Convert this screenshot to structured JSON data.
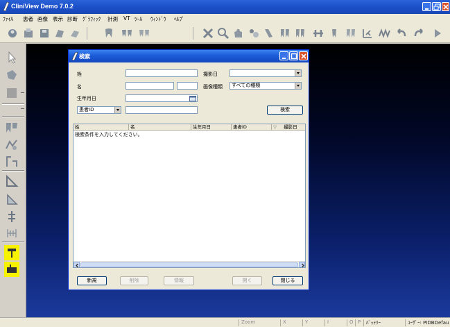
{
  "app": {
    "title": "CliniView Demo 7.0.2",
    "menu": [
      "ﾌｧｲﾙ",
      "患者",
      "画像",
      "表示",
      "診断",
      "ｸﾞﾗﾌｨｯｸ",
      "計測",
      "VT",
      "ﾂｰﾙ",
      "ｳｨﾝﾄﾞｳ",
      "ﾍﾙﾌﾟ"
    ]
  },
  "colors": {
    "titlebar": "#1b50c9",
    "workspace_top": "#000000",
    "workspace_bottom": "#1a3a9c",
    "highlight_yellow": "#f7f300",
    "close_red": "#d9532c"
  },
  "toolbar": {
    "icons": [
      "patient-open-icon",
      "import-icon",
      "save-icon",
      "capture-icon",
      "eraser-icon",
      "tooth-icon",
      "tooth-pair-icon",
      "tooth-group-icon",
      "delete-x-icon",
      "zoom-icon",
      "pan-hand-icon",
      "contrast-icon",
      "filter-icon",
      "tooth-view-icon",
      "tooth-layout-icon",
      "tooth-layout-2-icon",
      "tooth-layout-3-icon",
      "tooth-layout-4-icon",
      "grid-view-icon",
      "panorama-icon",
      "undo-icon",
      "redo-icon"
    ]
  },
  "left_tools": {
    "icons": [
      "pointer-icon",
      "shape-icon",
      "color-fill-icon",
      "line-style-icon",
      "image-enhance-icon",
      "measure-tool-icon",
      "angle-tool-icon",
      "ruler-icon",
      "triangle-icon",
      "height-icon",
      "distance-icon",
      "implant-icon",
      "implant-marker-icon"
    ]
  },
  "dialog": {
    "title": "検索",
    "labels": {
      "surname": "姓",
      "given_name": "名",
      "dob": "生年月日",
      "capture_date": "撮影日",
      "image_type": "画像種類"
    },
    "fields": {
      "surname": "",
      "given_name": "",
      "given_name_2": "",
      "dob": "",
      "capture_date": "",
      "image_type": "すべての種類",
      "id_type": "患者ID",
      "id_value": ""
    },
    "search_button": "検索",
    "results": {
      "columns": [
        "姓",
        "名",
        "生年月日",
        "患者ID",
        "撮影日"
      ],
      "sort_indicator": "▽",
      "message": "検索条件を入力してください。"
    },
    "buttons": {
      "new": "新規",
      "delete": "削除",
      "info": "情報",
      "open": "開く",
      "close": "閉じる"
    }
  },
  "status": {
    "zoom": "Zoom",
    "x": "X",
    "y": "Y",
    "i": "I",
    "o": "O",
    "p": "P",
    "battery": "ﾊﾞｯﾃﾘｰ",
    "user": "ﾕｰｻﾞｰ: PIDBDefau"
  }
}
